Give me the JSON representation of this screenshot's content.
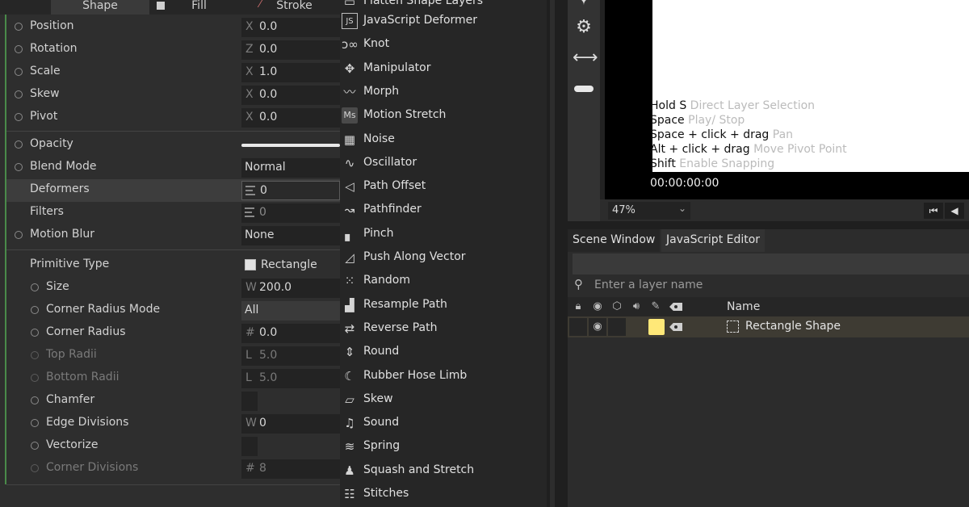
{
  "properties_panel": {
    "tabs": [
      {
        "label": "Shape",
        "active": true
      },
      {
        "label": "Fill",
        "active": false
      },
      {
        "label": "Stroke",
        "active": false
      }
    ],
    "transform": [
      {
        "label": "Position",
        "prefix": "X",
        "value": "0.0"
      },
      {
        "label": "Rotation",
        "prefix": "Z",
        "value": "0.0"
      },
      {
        "label": "Scale",
        "prefix": "X",
        "value": "1.0"
      },
      {
        "label": "Skew",
        "prefix": "X",
        "value": "0.0"
      },
      {
        "label": "Pivot",
        "prefix": "X",
        "value": "0.0"
      }
    ],
    "layer": {
      "opacity_label": "Opacity",
      "opacity_value": 1.0,
      "blend_label": "Blend Mode",
      "blend_value": "Normal",
      "deformers_label": "Deformers",
      "deformers_value": "0",
      "filters_label": "Filters",
      "filters_value": "0",
      "motion_blur_label": "Motion Blur",
      "motion_blur_value": "None"
    },
    "primitive": {
      "type_label": "Primitive Type",
      "type_value": "Rectangle",
      "size_label": "Size",
      "size_prefix": "W",
      "size_value": "200.0",
      "corner_mode_label": "Corner Radius Mode",
      "corner_mode_value": "All",
      "corner_radius_label": "Corner Radius",
      "corner_radius_prefix": "#",
      "corner_radius_value": "0.0",
      "top_radii_label": "Top Radii",
      "top_radii_prefix": "L",
      "top_radii_value": "5.0",
      "bottom_radii_label": "Bottom Radii",
      "bottom_radii_prefix": "L",
      "bottom_radii_value": "5.0",
      "chamfer_label": "Chamfer",
      "edge_divisions_label": "Edge Divisions",
      "edge_divisions_prefix": "W",
      "edge_divisions_value": "0",
      "vectorize_label": "Vectorize",
      "corner_divisions_label": "Corner Divisions",
      "corner_divisions_prefix": "#",
      "corner_divisions_value": "8"
    }
  },
  "deformer_menu": {
    "partial_top_label": "Flatten Shape Layers",
    "items": [
      {
        "label": "JavaScript Deformer",
        "icon": "js-icon",
        "glyph": "JS"
      },
      {
        "label": "Knot",
        "icon": "knot-icon",
        "glyph": "ↄ∞"
      },
      {
        "label": "Manipulator",
        "icon": "manipulator-icon",
        "glyph": "✥"
      },
      {
        "label": "Morph",
        "icon": "morph-icon",
        "glyph": "〰"
      },
      {
        "label": "Motion Stretch",
        "icon": "motion-stretch-icon",
        "glyph": "Ms"
      },
      {
        "label": "Noise",
        "icon": "noise-icon",
        "glyph": "▦"
      },
      {
        "label": "Oscillator",
        "icon": "oscillator-icon",
        "glyph": "∿"
      },
      {
        "label": "Path Offset",
        "icon": "path-offset-icon",
        "glyph": "◁"
      },
      {
        "label": "Pathfinder",
        "icon": "pathfinder-icon",
        "glyph": "↝"
      },
      {
        "label": "Pinch",
        "icon": "pinch-icon",
        "glyph": "▖"
      },
      {
        "label": "Push Along Vector",
        "icon": "push-along-vector-icon",
        "glyph": "◿"
      },
      {
        "label": "Random",
        "icon": "random-icon",
        "glyph": "⁙"
      },
      {
        "label": "Resample Path",
        "icon": "resample-path-icon",
        "glyph": "▟"
      },
      {
        "label": "Reverse Path",
        "icon": "reverse-path-icon",
        "glyph": "⇄"
      },
      {
        "label": "Round",
        "icon": "round-icon",
        "glyph": "⇕"
      },
      {
        "label": "Rubber Hose Limb",
        "icon": "rubber-hose-limb-icon",
        "glyph": "☾"
      },
      {
        "label": "Skew",
        "icon": "skew-icon",
        "glyph": "▱"
      },
      {
        "label": "Sound",
        "icon": "sound-icon",
        "glyph": "♫"
      },
      {
        "label": "Spring",
        "icon": "spring-icon",
        "glyph": "≋"
      },
      {
        "label": "Squash and Stretch",
        "icon": "squash-and-stretch-icon",
        "glyph": "♟"
      },
      {
        "label": "Stitches",
        "icon": "stitches-icon",
        "glyph": "☷"
      }
    ]
  },
  "viewport": {
    "hints": [
      {
        "key": "Hold S",
        "action": "Direct Layer Selection"
      },
      {
        "key": "Space",
        "action": "Play/ Stop"
      },
      {
        "key": "Space + click + drag",
        "action": "Pan"
      },
      {
        "key": "Alt + click + drag",
        "action": "Move Pivot Point"
      },
      {
        "key": "Shift",
        "action": "Enable Snapping"
      }
    ],
    "timecode": "00:00:00:00",
    "zoom": "47%"
  },
  "scene": {
    "tabs": [
      {
        "label": "Scene Window",
        "active": true
      },
      {
        "label": "JavaScript Editor",
        "active": false
      }
    ],
    "search_placeholder": "Enter a layer name",
    "name_header": "Name",
    "layers": [
      {
        "name": "Rectangle Shape",
        "color": "#ffe878"
      }
    ]
  },
  "colors": {
    "accent_green": "#4a8a4a",
    "layer_color": "#ffe878",
    "selected_row": "#3e3b33"
  }
}
